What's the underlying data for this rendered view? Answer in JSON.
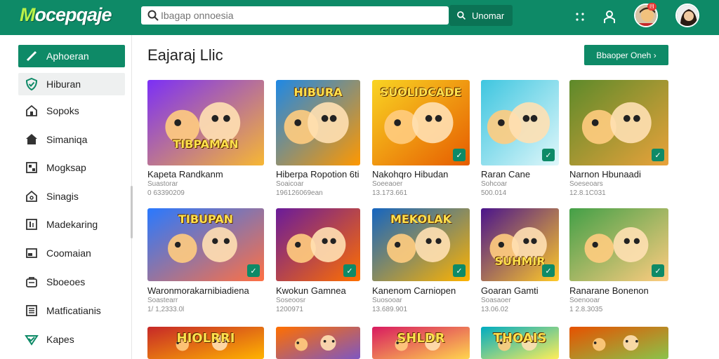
{
  "app": {
    "logo_part1": "M",
    "logo_part2": "ocepqaje",
    "search_placeholder": "Ibagap onnoesia",
    "search_button": "Unomar",
    "notification_badge": "I!I"
  },
  "sidebar": {
    "items": [
      {
        "label": "Aphoeran",
        "icon": "pencil-icon"
      },
      {
        "label": "Hiburan",
        "icon": "shield-check-icon"
      },
      {
        "label": "Sopoks",
        "icon": "home-icon"
      },
      {
        "label": "Simaniqa",
        "icon": "house-icon"
      },
      {
        "label": "Mogksap",
        "icon": "puzzle-icon"
      },
      {
        "label": "Sinagis",
        "icon": "home-outline-icon"
      },
      {
        "label": "Madekaring",
        "icon": "info-box-icon"
      },
      {
        "label": "Coomaian",
        "icon": "window-icon"
      },
      {
        "label": "Sboeoes",
        "icon": "bag-icon"
      },
      {
        "label": "Matficatianis",
        "icon": "list-icon"
      },
      {
        "label": "Kapes",
        "icon": "chevron-check-icon"
      }
    ]
  },
  "main": {
    "title": "Eajaraj Llic",
    "browse_button": "Bbaoper Oneh ›"
  },
  "games": [
    {
      "title": "Kapeta Randkanm",
      "sub": "Suastorar",
      "meta": "0 63390209",
      "art": "TIBPAMAN",
      "c1": "#7b2ff7",
      "c2": "#f7b733"
    },
    {
      "title": "Hiberpa Ropotion 6ti",
      "sub": "Soaicoar",
      "meta": "196126069ean",
      "art": "HIBURA",
      "c1": "#1e88e5",
      "c2": "#ff9800"
    },
    {
      "title": "Nakohqro Hibudan",
      "sub": "Soeeaoer",
      "meta": "13.173.661",
      "art": "SUOLIDCADE",
      "c1": "#f9d423",
      "c2": "#e65c00"
    },
    {
      "title": "Raran Cane",
      "sub": "Sohcoar",
      "meta": "500.014",
      "art": "",
      "c1": "#3ec6e0",
      "c2": "#e0f7fa"
    },
    {
      "title": "Narnon Hbunaadi",
      "sub": "Soeseoars",
      "meta": "12.8.1C031",
      "art": "",
      "c1": "#5d8a2a",
      "c2": "#e9a23b"
    },
    {
      "title": "Waronmorakarnibiadiena",
      "sub": "Soastearr",
      "meta": "1/ 1,2333.0l",
      "art": "TIBUPAN",
      "c1": "#2979ff",
      "c2": "#ff7043"
    },
    {
      "title": "Kwokun Gamnea",
      "sub": "Soseoosr",
      "meta": "1200971",
      "art": "",
      "c1": "#6a1b9a",
      "c2": "#ff6f00"
    },
    {
      "title": "Kanenom Carniopen",
      "sub": "Suosooar",
      "meta": "13.689.901",
      "art": "MEKOLAK",
      "c1": "#1565c0",
      "c2": "#ffb300"
    },
    {
      "title": "Goaran Gamti",
      "sub": "Soasaoer",
      "meta": "13.06.02",
      "art": "SUHMIR",
      "c1": "#4a148c",
      "c2": "#ffca28"
    },
    {
      "title": "Ranarane Bonenon",
      "sub": "Soenooar",
      "meta": "1 2.8.3035",
      "art": "",
      "c1": "#43a047",
      "c2": "#ffcc80"
    },
    {
      "title": "",
      "sub": "",
      "meta": "",
      "art": "HIOLRRI",
      "c1": "#c62828",
      "c2": "#ffb300"
    },
    {
      "title": "",
      "sub": "",
      "meta": "",
      "art": "",
      "c1": "#ff6f00",
      "c2": "#7e57c2"
    },
    {
      "title": "",
      "sub": "",
      "meta": "",
      "art": "SHLDR",
      "c1": "#d81b60",
      "c2": "#ffd54f"
    },
    {
      "title": "",
      "sub": "",
      "meta": "",
      "art": "THOAIS",
      "c1": "#00acc1",
      "c2": "#ffee58"
    },
    {
      "title": "",
      "sub": "",
      "meta": "",
      "art": "",
      "c1": "#e65100",
      "c2": "#8bc34a"
    }
  ],
  "colors": {
    "brand": "#0e8a67",
    "brand_dark": "#0b7355"
  }
}
